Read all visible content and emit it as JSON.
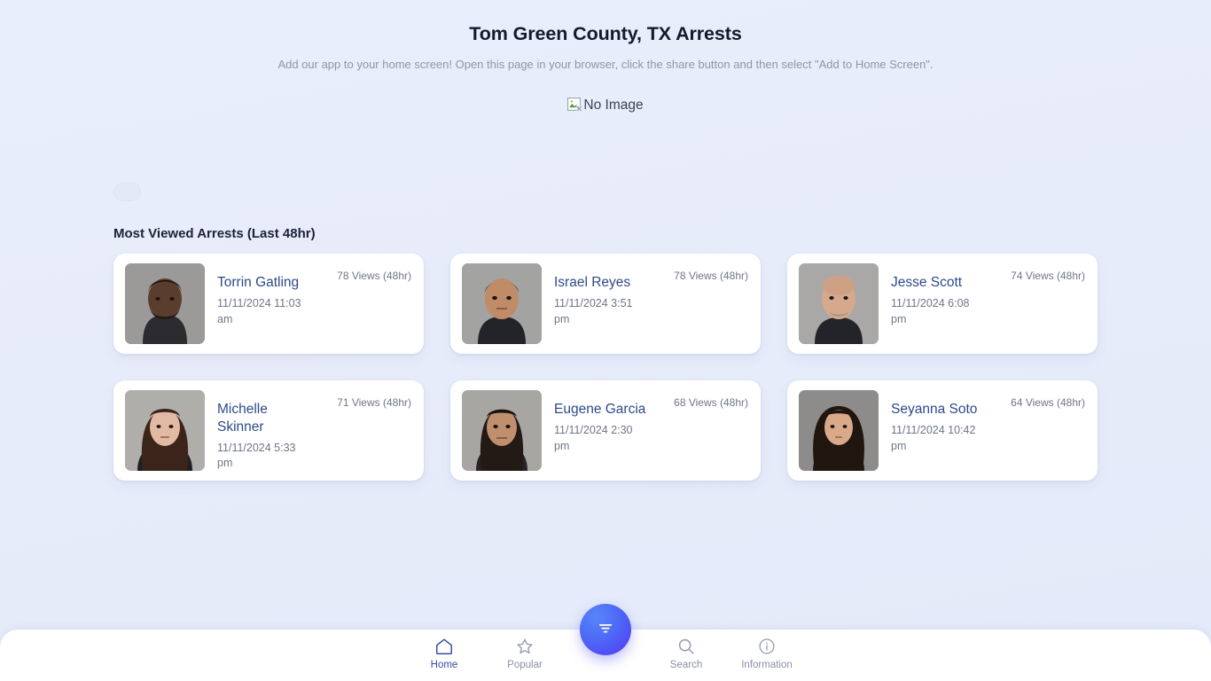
{
  "header": {
    "title": "Tom Green County, TX Arrests",
    "subtitle": "Add our app to your home screen! Open this page in your browser, click the share button and then select \"Add to Home Screen\"."
  },
  "hero": {
    "broken_image_alt": "No Image",
    "icon": "broken-image-icon"
  },
  "filter_pill": {
    "label": ""
  },
  "section": {
    "heading": "Most Viewed Arrests (Last 48hr)",
    "cards": [
      {
        "name": "Torrin Gatling",
        "date": "11/11/2024 11:03 am",
        "views": "78 Views (48hr)",
        "mugshot_alt": "Torrin Gatling mugshot"
      },
      {
        "name": "Israel Reyes",
        "date": "11/11/2024 3:51 pm",
        "views": "78 Views (48hr)",
        "mugshot_alt": "Israel Reyes mugshot"
      },
      {
        "name": "Jesse Scott",
        "date": "11/11/2024 6:08 pm",
        "views": "74 Views (48hr)",
        "mugshot_alt": "Jesse Scott mugshot"
      },
      {
        "name": "Michelle Skinner",
        "date": "11/11/2024 5:33 pm",
        "views": "71 Views (48hr)",
        "mugshot_alt": "Michelle Skinner mugshot"
      },
      {
        "name": "Eugene Garcia",
        "date": "11/11/2024 2:30 pm",
        "views": "68 Views (48hr)",
        "mugshot_alt": "Eugene Garcia mugshot"
      },
      {
        "name": "Seyanna Soto",
        "date": "11/11/2024 10:42 pm",
        "views": "64 Views (48hr)",
        "mugshot_alt": "Seyanna Soto mugshot"
      }
    ]
  },
  "bottom_nav": {
    "items": [
      {
        "label": "Home",
        "icon": "home-icon",
        "active": true
      },
      {
        "label": "Popular",
        "icon": "star-icon",
        "active": false
      },
      {
        "label": "Search",
        "icon": "search-icon",
        "active": false
      },
      {
        "label": "Information",
        "icon": "info-icon",
        "active": false
      }
    ],
    "fab": {
      "icon": "filter-icon",
      "label": "Filter"
    }
  },
  "colors": {
    "page_background": "#e8edfa",
    "card_background": "#ffffff",
    "link": "#2d4a8a",
    "muted_text": "#6f7686",
    "active_nav": "#3a4ba8",
    "fab_gradient_start": "#5a84fb",
    "fab_gradient_end": "#5436f2"
  }
}
